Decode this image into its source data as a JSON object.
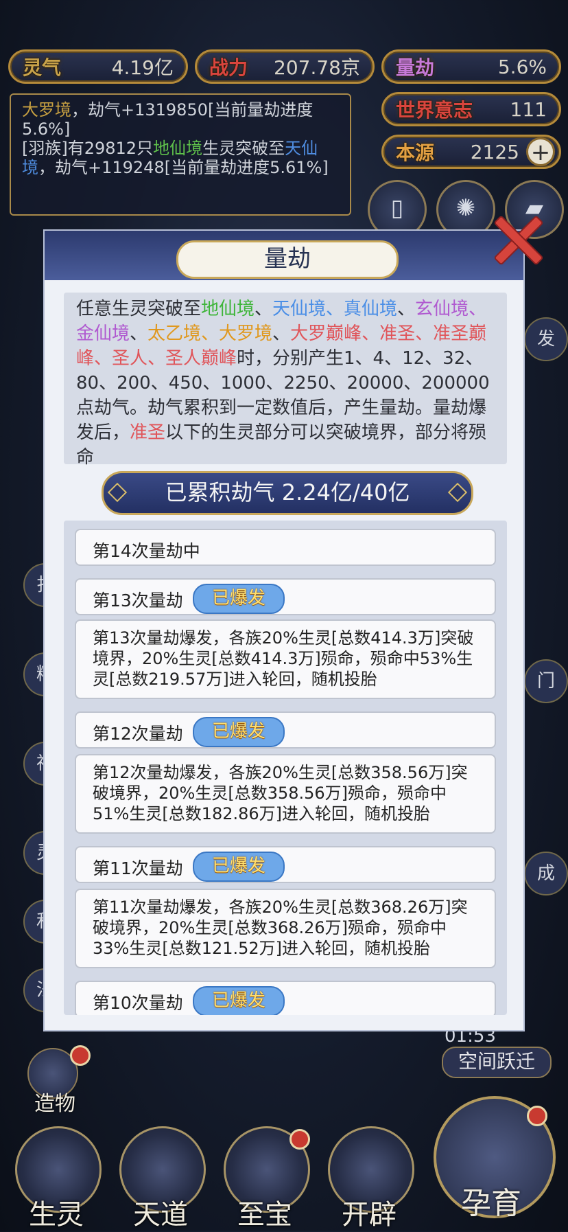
{
  "stats": {
    "lingqi": {
      "label": "灵气",
      "value": "4.19亿"
    },
    "zhanli": {
      "label": "战力",
      "value": "207.78京"
    },
    "liangjie": {
      "label": "量劫",
      "value": "5.6%"
    },
    "shijie": {
      "label": "世界意志",
      "value": "111"
    },
    "benyuan": {
      "label": "本源",
      "value": "2125"
    }
  },
  "log": {
    "line1_realm": "大罗境",
    "line1_rest": "，劫气+1319850[当前量劫进度5.6%]",
    "line2_a": "[羽族]有29812只",
    "line2_realm1": "地仙境",
    "line2_b": "生灵突破至",
    "line2_realm2": "天仙境",
    "line2_rest": "，劫气+119248[当前量劫进度5.61%]"
  },
  "modal": {
    "title": "量劫",
    "desc": {
      "p1": "任意生灵突破至",
      "r1": "地仙境",
      "s1": "、",
      "r2": "天仙境、真仙境",
      "s2": "、",
      "r3": "玄仙境、金仙境",
      "s3": "、",
      "r4": "太乙境、大罗境",
      "s4": "、",
      "r5": "大罗巅峰、准圣、准圣巅峰、圣人、圣人巅峰",
      "p2": "时，分别产生1、4、12、32、80、200、450、1000、2250、20000、200000点劫气。劫气累积到一定数值后，产生量劫。量劫爆发后，",
      "r6": "准圣",
      "p3": "以下的生灵部分可以突破境界，部分将殒命"
    },
    "accumulated": "已累积劫气 2.24亿/40亿",
    "entries": [
      {
        "title": "第14次量劫中"
      },
      {
        "title": "第13次量劫",
        "badge": "已爆发",
        "detail": "第13次量劫爆发，各族20%生灵[总数414.3万]突破境界，20%生灵[总数414.3万]殒命，殒命中53%生灵[总数219.57万]进入轮回，随机投胎"
      },
      {
        "title": "第12次量劫",
        "badge": "已爆发",
        "detail": "第12次量劫爆发，各族20%生灵[总数358.56万]突破境界，20%生灵[总数358.56万]殒命，殒命中51%生灵[总数182.86万]进入轮回，随机投胎"
      },
      {
        "title": "第11次量劫",
        "badge": "已爆发",
        "detail": "第11次量劫爆发，各族20%生灵[总数368.26万]突破境界，20%生灵[总数368.26万]殒命，殒命中33%生灵[总数121.52万]进入轮回，随机投胎"
      },
      {
        "title": "第10次量劫",
        "badge": "已爆发"
      }
    ]
  },
  "side_bg": {
    "right_fa": "发",
    "right_men": "门",
    "right_cheng": "成",
    "timer": "01:53",
    "jump": "空间跃迁",
    "zaowu": "造物"
  },
  "nav": [
    {
      "label": "生灵"
    },
    {
      "label": "天道"
    },
    {
      "label": "至宝"
    },
    {
      "label": "开辟"
    },
    {
      "label": "孕育"
    }
  ],
  "colors": {
    "accent_gold": "#c9a85a",
    "badge_blue": "#6ea8e9",
    "close_red": "#d6443c"
  }
}
